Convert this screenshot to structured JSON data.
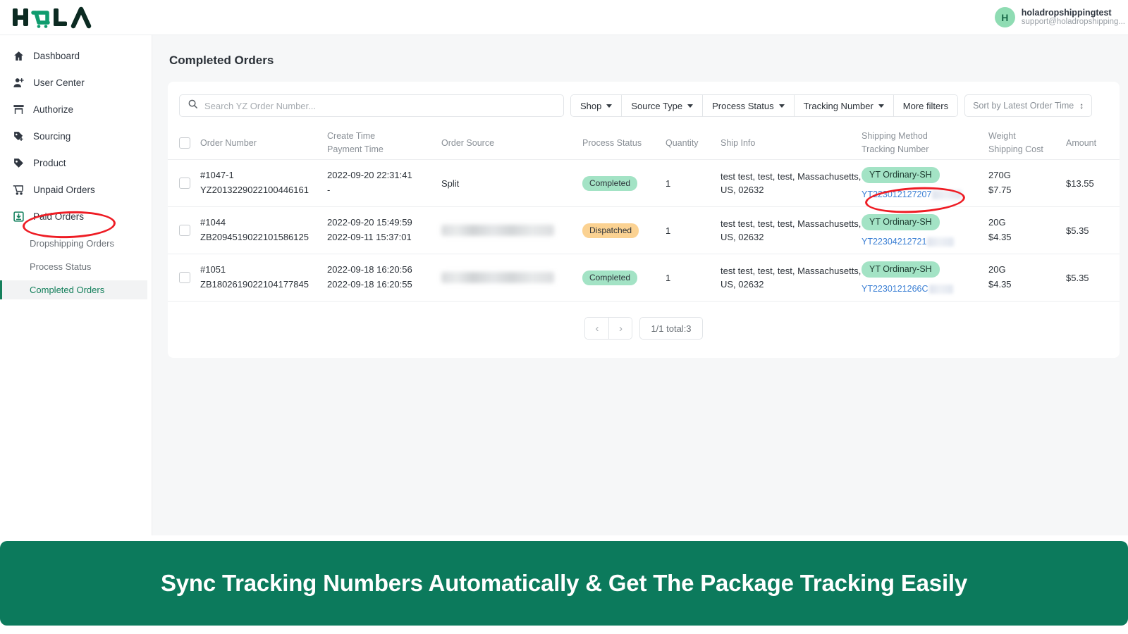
{
  "brand": {
    "logo_text": "HOLA",
    "accent": "#0c7a5c"
  },
  "header": {
    "user_name": "holadropshippingtest",
    "user_email": "support@holadropshipping...",
    "avatar_initial": "H"
  },
  "sidebar": {
    "items": [
      {
        "label": "Dashboard",
        "icon": "home-icon"
      },
      {
        "label": "User Center",
        "icon": "user-add-icon"
      },
      {
        "label": "Authorize",
        "icon": "store-icon"
      },
      {
        "label": "Sourcing",
        "icon": "tag-add-icon"
      },
      {
        "label": "Product",
        "icon": "tag-icon"
      },
      {
        "label": "Unpaid Orders",
        "icon": "cart-icon"
      },
      {
        "label": "Paid Orders",
        "icon": "inbox-down-icon"
      }
    ],
    "sub_items": [
      {
        "label": "Dropshipping Orders",
        "active": false
      },
      {
        "label": "Process Status",
        "active": false
      },
      {
        "label": "Completed Orders",
        "active": true
      }
    ]
  },
  "main": {
    "page_title": "Completed Orders",
    "search": {
      "placeholder": "Search YZ Order Number...",
      "value": ""
    },
    "filters": [
      {
        "label": "Shop",
        "has_caret": true
      },
      {
        "label": "Source Type",
        "has_caret": true
      },
      {
        "label": "Process Status",
        "has_caret": true
      },
      {
        "label": "Tracking Number",
        "has_caret": true
      },
      {
        "label": "More filters",
        "has_caret": false
      }
    ],
    "sort": {
      "label": "Sort by Latest Order Time",
      "glyph": "↕"
    },
    "table": {
      "headers": {
        "order_number": "Order Number",
        "create_time": "Create Time",
        "payment_time": "Payment Time",
        "order_source": "Order Source",
        "process_status": "Process Status",
        "quantity": "Quantity",
        "ship_info": "Ship Info",
        "shipping_method": "Shipping Method",
        "tracking_number": "Tracking Number",
        "weight": "Weight",
        "shipping_cost": "Shipping Cost",
        "amount": "Amount"
      },
      "rows": [
        {
          "order_id": "#1047-1",
          "order_ref": "YZ2013229022100446161",
          "create_time": "2022-09-20 22:31:41",
          "payment_time": "-",
          "order_source": "Split",
          "order_source_blurred": false,
          "process_status": "Completed",
          "status_type": "completed",
          "quantity": "1",
          "ship_info": "test test, test, test, Massachusetts, US, 02632",
          "shipping_method": "YT Ordinary-SH",
          "tracking_number": "YT223012127207",
          "tracking_blurred": true,
          "weight": "270G",
          "shipping_cost": "$7.75",
          "amount": "$13.55"
        },
        {
          "order_id": "#1044",
          "order_ref": "ZB2094519022101586125",
          "create_time": "2022-09-20 15:49:59",
          "payment_time": "2022-09-11 15:37:01",
          "order_source": "",
          "order_source_blurred": true,
          "process_status": "Dispatched",
          "status_type": "dispatched",
          "quantity": "1",
          "ship_info": "test test, test, test, Massachusetts, US, 02632",
          "shipping_method": "YT Ordinary-SH",
          "tracking_number": "YT22304212721",
          "tracking_blurred": true,
          "weight": "20G",
          "shipping_cost": "$4.35",
          "amount": "$5.35"
        },
        {
          "order_id": "#1051",
          "order_ref": "ZB1802619022104177845",
          "create_time": "2022-09-18 16:20:56",
          "payment_time": "2022-09-18 16:20:55",
          "order_source": "",
          "order_source_blurred": true,
          "process_status": "Completed",
          "status_type": "completed",
          "quantity": "1",
          "ship_info": "test test, test, test, Massachusetts, US, 02632",
          "shipping_method": "YT Ordinary-SH",
          "tracking_number": "YT2230121266C",
          "tracking_blurred": true,
          "weight": "20G",
          "shipping_cost": "$4.35",
          "amount": "$5.35"
        }
      ]
    },
    "pagination": {
      "prev": "‹",
      "next": "›",
      "total_label": "1/1 total:3"
    }
  },
  "banner": {
    "text": "Sync Tracking Numbers Automatically & Get The Package Tracking Easily"
  },
  "annotations": {
    "color": "#ee1c24"
  }
}
